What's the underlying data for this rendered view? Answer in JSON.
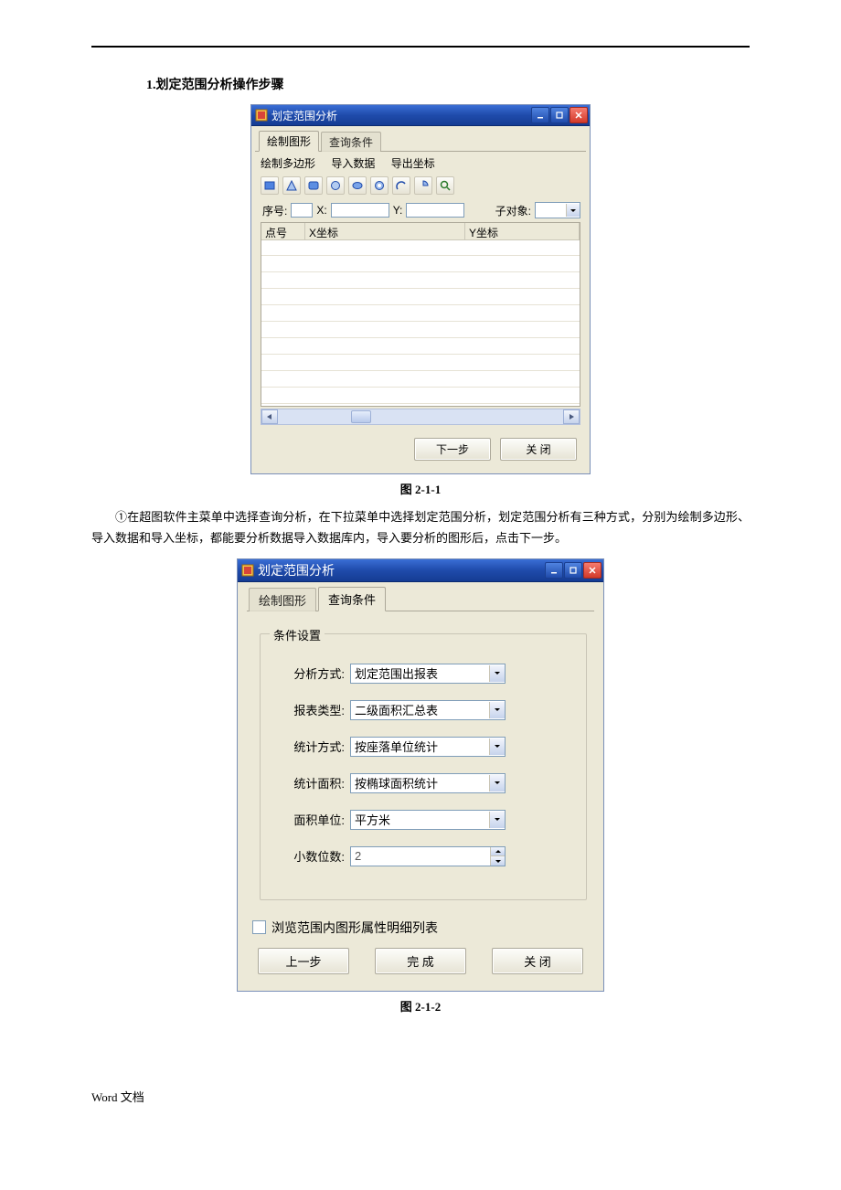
{
  "doc": {
    "section_title": "1.划定范围分析操作步骤",
    "fig1_caption": "图 2-1-1",
    "para1": "①在超图软件主菜单中选择查询分析，在下拉菜单中选择划定范围分析，划定范围分析有三种方式，分别为绘制多边形、导入数据和导入坐标，都能要分析数据导入数据库内，导入要分析的图形后，点击下一步。",
    "fig2_caption": "图 2-1-2",
    "footer": "Word 文档"
  },
  "win1": {
    "title": "划定范围分析",
    "tabs": {
      "active": "绘制图形",
      "inactive": "查询条件"
    },
    "menu": {
      "item1": "绘制多边形",
      "item2": "导入数据",
      "item3": "导出坐标"
    },
    "params": {
      "seq_label": "序号:",
      "x_label": "X:",
      "y_label": "Y:",
      "sub_label": "子对象:"
    },
    "grid": {
      "col1": "点号",
      "col2": "X坐标",
      "col3": "Y坐标"
    },
    "buttons": {
      "next": "下一步",
      "close": "关 闭"
    }
  },
  "win2": {
    "title": "划定范围分析",
    "tabs": {
      "inactive": "绘制图形",
      "active": "查询条件"
    },
    "group": "条件设置",
    "fields": {
      "analysis_mode": {
        "label": "分析方式:",
        "value": "划定范围出报表"
      },
      "report_type": {
        "label": "报表类型:",
        "value": "二级面积汇总表"
      },
      "stat_mode": {
        "label": "统计方式:",
        "value": "按座落单位统计"
      },
      "stat_area": {
        "label": "统计面积:",
        "value": "按椭球面积统计"
      },
      "area_unit": {
        "label": "面积单位:",
        "value": "平方米"
      },
      "decimals": {
        "label": "小数位数:",
        "value": "2"
      }
    },
    "checkbox_label": "浏览范围内图形属性明细列表",
    "buttons": {
      "prev": "上一步",
      "finish": "完 成",
      "close": "关 闭"
    }
  }
}
